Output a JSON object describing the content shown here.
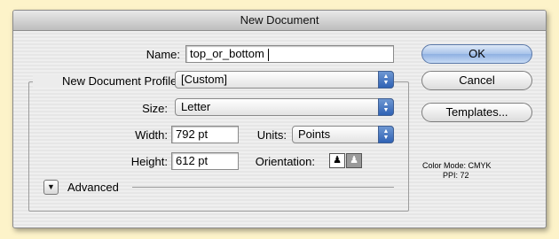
{
  "window": {
    "title": "New Document"
  },
  "name": {
    "label": "Name:",
    "value": "top_or_bottom"
  },
  "profile": {
    "label": "New Document Profile:",
    "value": "[Custom]"
  },
  "size": {
    "label": "Size:",
    "value": "Letter"
  },
  "width": {
    "label": "Width:",
    "value": "792 pt"
  },
  "height": {
    "label": "Height:",
    "value": "612 pt"
  },
  "units": {
    "label": "Units:",
    "value": "Points"
  },
  "orientation": {
    "label": "Orientation:",
    "portrait_icon": "portrait-person-icon",
    "landscape_icon": "landscape-person-icon"
  },
  "advanced": {
    "label": "Advanced",
    "icon": "disclosure-triangle-icon"
  },
  "buttons": {
    "ok": "OK",
    "cancel": "Cancel",
    "templates": "Templates..."
  },
  "info": {
    "color_mode": "Color Mode: CMYK",
    "ppi": "PPI: 72"
  }
}
